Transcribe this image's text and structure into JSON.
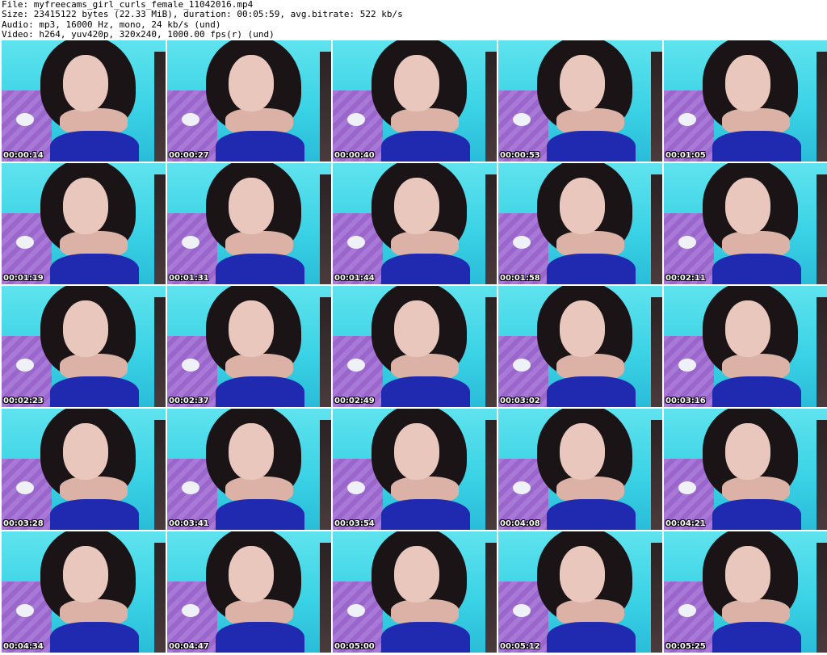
{
  "header": {
    "file_line": "File: myfreecams_girl_curls_female_11042016.mp4",
    "size_line": "Size: 23415122 bytes (22.33 MiB), duration: 00:05:59, avg.bitrate: 522 kb/s",
    "audio_line": "Audio: mp3, 16000 Hz, mono, 24 kb/s (und)",
    "video_line": "Video: h264, yuv420p, 320x240, 1000.00 fps(r) (und)"
  },
  "colors": {
    "background": "#ffffff",
    "wall": "#3bd3e6",
    "blanket": "#a879d6",
    "shirt": "#1f2ab0",
    "hair": "#1b1416",
    "timestamp_text": "#ffffff"
  },
  "thumbnails": [
    {
      "timestamp": "00:00:14"
    },
    {
      "timestamp": "00:00:27"
    },
    {
      "timestamp": "00:00:40"
    },
    {
      "timestamp": "00:00:53"
    },
    {
      "timestamp": "00:01:05"
    },
    {
      "timestamp": "00:01:19"
    },
    {
      "timestamp": "00:01:31"
    },
    {
      "timestamp": "00:01:44"
    },
    {
      "timestamp": "00:01:58"
    },
    {
      "timestamp": "00:02:11"
    },
    {
      "timestamp": "00:02:23"
    },
    {
      "timestamp": "00:02:37"
    },
    {
      "timestamp": "00:02:49"
    },
    {
      "timestamp": "00:03:02"
    },
    {
      "timestamp": "00:03:16"
    },
    {
      "timestamp": "00:03:28"
    },
    {
      "timestamp": "00:03:41"
    },
    {
      "timestamp": "00:03:54"
    },
    {
      "timestamp": "00:04:08"
    },
    {
      "timestamp": "00:04:21"
    },
    {
      "timestamp": "00:04:34"
    },
    {
      "timestamp": "00:04:47"
    },
    {
      "timestamp": "00:05:00"
    },
    {
      "timestamp": "00:05:12"
    },
    {
      "timestamp": "00:05:25"
    }
  ]
}
